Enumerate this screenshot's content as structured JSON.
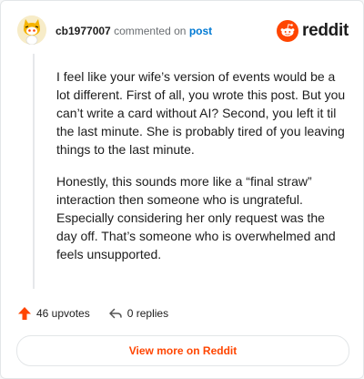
{
  "header": {
    "username": "cb1977007",
    "action_text": "commented on",
    "post_link": "post",
    "brand": "reddit"
  },
  "comment": {
    "paragraphs": [
      "I feel like your wife’s version of events would be a lot different. First of all, you wrote this post. But you can’t write a card without AI? Second, you left it til the last minute. She is probably tired of you leaving things to the last minute.",
      "Honestly, this sounds more like a “final straw” interaction then someone who is ungrateful. Especially considering her only request was the day off. That’s someone who is overwhelmed and feels unsupported."
    ]
  },
  "actions": {
    "upvotes": "46 upvotes",
    "replies": "0 replies"
  },
  "footer": {
    "view_more": "View more on Reddit"
  },
  "colors": {
    "brand_orange": "#ff4500",
    "link_blue": "#0079d3"
  },
  "icons": [
    "avatar-snoo",
    "reddit-logo-icon",
    "upvote-arrow-icon",
    "reply-icon"
  ]
}
